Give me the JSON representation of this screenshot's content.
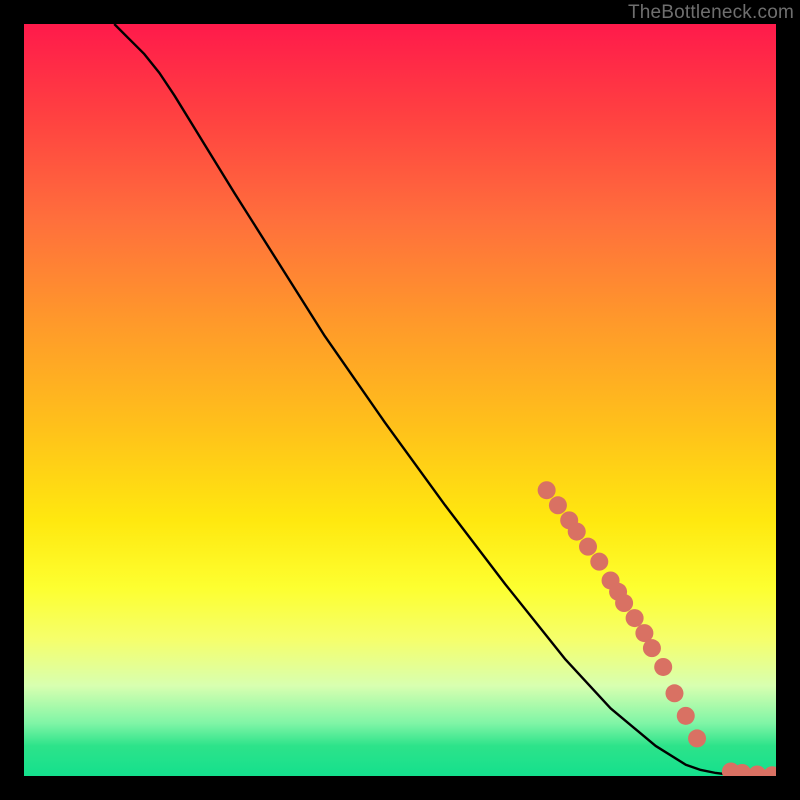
{
  "attribution": "TheBottleneck.com",
  "chart_data": {
    "type": "line",
    "title": "",
    "xlabel": "",
    "ylabel": "",
    "xlim": [
      0,
      100
    ],
    "ylim": [
      0,
      100
    ],
    "curve": {
      "name": "curve",
      "x": [
        12,
        14,
        16,
        18,
        20,
        24,
        28,
        34,
        40,
        48,
        56,
        64,
        72,
        78,
        84,
        88,
        90,
        92,
        94,
        96,
        98,
        100
      ],
      "y": [
        100,
        98,
        96,
        93.5,
        90.5,
        84,
        77.5,
        68,
        58.5,
        47,
        36,
        25.5,
        15.5,
        9,
        4,
        1.5,
        0.8,
        0.4,
        0.15,
        0,
        0,
        0
      ]
    },
    "markers": {
      "name": "points",
      "color": "#d97163",
      "radius_px": 9,
      "x": [
        69.5,
        71,
        72.5,
        73.5,
        75,
        76.5,
        78,
        79,
        79.8,
        81.2,
        82.5,
        83.5,
        85,
        86.5,
        88,
        89.5,
        94,
        95.5,
        97.5,
        99.5
      ],
      "y": [
        38,
        36,
        34,
        32.5,
        30.5,
        28.5,
        26,
        24.5,
        23,
        21,
        19,
        17,
        14.5,
        11,
        8,
        5,
        0.6,
        0.4,
        0.2,
        0.1
      ]
    },
    "bottom_band_color": "#14e08d"
  }
}
